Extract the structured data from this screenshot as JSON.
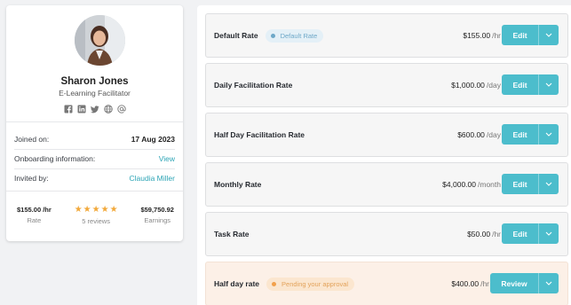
{
  "profile": {
    "name": "Sharon Jones",
    "role": "E-Learning Facilitator",
    "socials": [
      "facebook-icon",
      "linkedin-icon",
      "twitter-icon",
      "globe-icon",
      "at-icon"
    ],
    "joined_label": "Joined on:",
    "joined_value": "17 Aug 2023",
    "onboarding_label": "Onboarding information:",
    "onboarding_link": "View",
    "invited_label": "Invited by:",
    "invited_link": "Claudia Miller",
    "stats": {
      "rate_value": "$155.00 /hr",
      "rate_label": "Rate",
      "rating_stars": 5,
      "reviews_label": "5 reviews",
      "earnings_value": "$59,750.92",
      "earnings_label": "Earnings"
    }
  },
  "rates": [
    {
      "name": "Default Rate",
      "badge": "Default Rate",
      "badge_type": "info",
      "amount": "$155.00",
      "unit": "/hr",
      "button": "Edit"
    },
    {
      "name": "Daily Facilitation Rate",
      "amount": "$1,000.00",
      "unit": "/day",
      "button": "Edit"
    },
    {
      "name": "Half Day Facilitation Rate",
      "amount": "$600.00",
      "unit": "/day",
      "button": "Edit"
    },
    {
      "name": "Monthly Rate",
      "amount": "$4,000.00",
      "unit": "/month",
      "button": "Edit"
    },
    {
      "name": "Task Rate",
      "amount": "$50.00",
      "unit": "/hr",
      "button": "Edit"
    },
    {
      "name": "Half day rate",
      "badge": "Pending your approval",
      "badge_type": "warn",
      "amount": "$400.00",
      "unit": "/hr",
      "button": "Review"
    }
  ],
  "colors": {
    "accent": "#4cbdcc",
    "link": "#2ea5b6",
    "star": "#f2a93b",
    "pending_bg": "#fcf0e7"
  }
}
